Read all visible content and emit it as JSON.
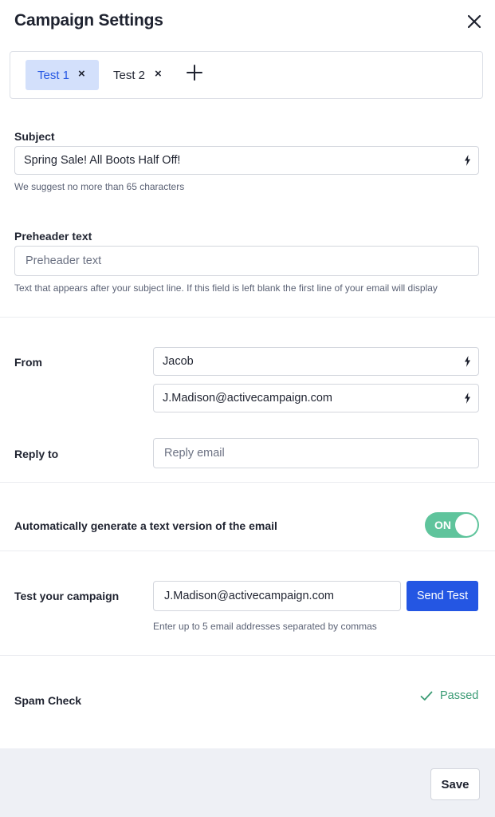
{
  "header": {
    "title": "Campaign Settings",
    "close_icon": "close-icon"
  },
  "tabs": [
    {
      "label": "Test 1",
      "remove": "×",
      "active": true
    },
    {
      "label": "Test 2",
      "remove": "×",
      "active": false
    }
  ],
  "add_tab_icon": "plus-icon",
  "subject": {
    "label": "Subject",
    "value": "Spring Sale! All Boots Half Off!",
    "helper": "We suggest no more than 65 characters",
    "icon": "lightning-bolt-icon"
  },
  "preheader": {
    "label": "Preheader text",
    "placeholder": "Preheader text",
    "value": "",
    "helper": "Text that appears after your subject line. If this field is left blank the first line of your email will display"
  },
  "from": {
    "label": "From",
    "name_value": "Jacob",
    "email_value": "J.Madison@activecampaign.com",
    "icon": "lightning-bolt-icon"
  },
  "reply_to": {
    "label": "Reply to",
    "placeholder": "Reply email",
    "value": ""
  },
  "text_version": {
    "label": "Automatically generate a text version of the email",
    "toggle_label": "ON",
    "enabled": true
  },
  "test_campaign": {
    "label": "Test your campaign",
    "value": "J.Madison@activecampaign.com",
    "button": "Send Test",
    "helper": "Enter up to 5 email addresses separated by commas"
  },
  "spam_check": {
    "label": "Spam Check",
    "status": "Passed",
    "icon": "check-icon"
  },
  "footer": {
    "save": "Save"
  },
  "colors": {
    "accent": "#2456e3",
    "active_tab_bg": "#d3e0fb",
    "toggle_on": "#5fc49c",
    "passed": "#3a9b74",
    "footer_bg": "#eef0f5"
  }
}
